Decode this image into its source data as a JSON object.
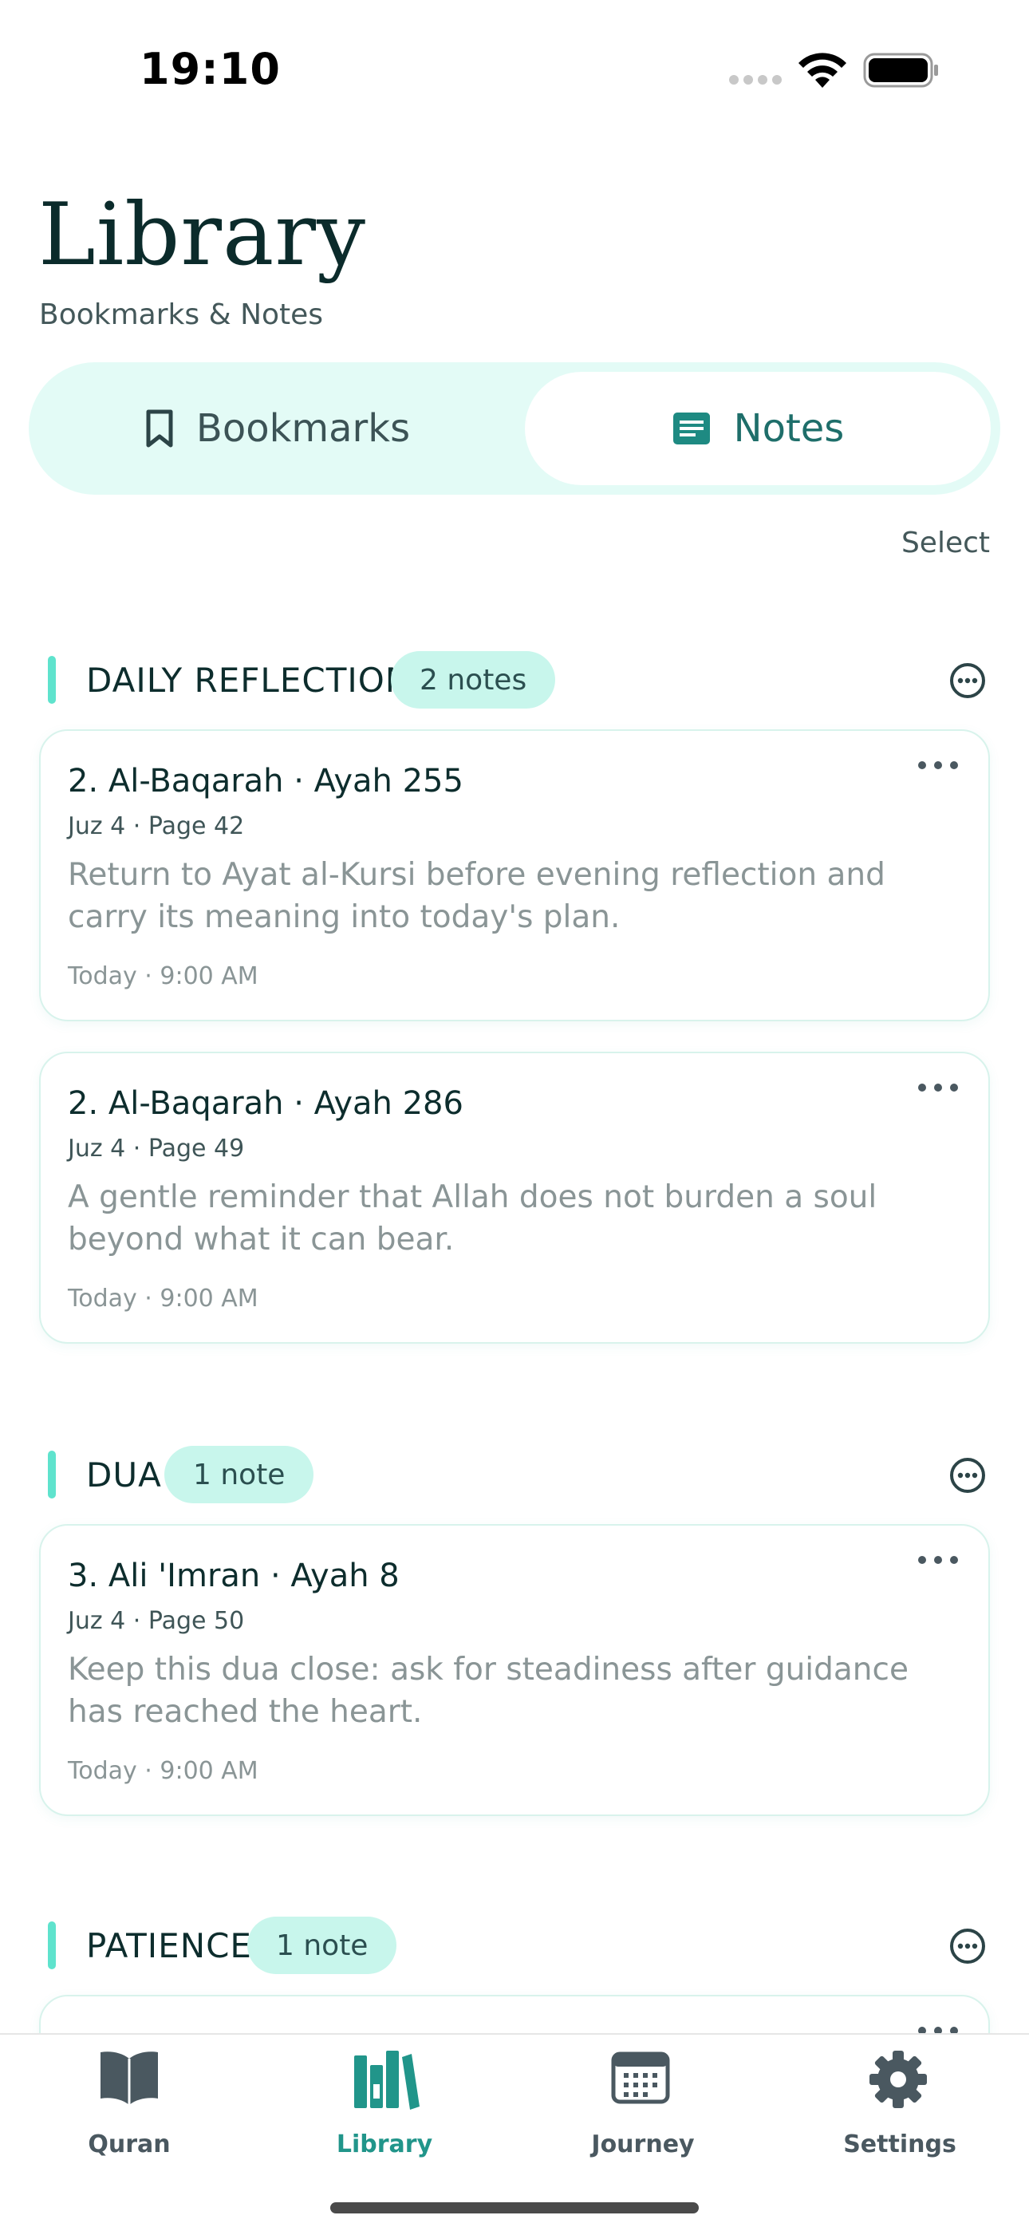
{
  "status_bar": {
    "time": "19:10"
  },
  "header": {
    "title": "Library",
    "subtitle": "Bookmarks & Notes"
  },
  "segmented": {
    "bookmarks_label": "Bookmarks",
    "notes_label": "Notes",
    "active": "Notes"
  },
  "select_label": "Select",
  "colors": {
    "accent": "#5fe3cd",
    "pill": "#c8f6ec",
    "active_tab": "#21958a",
    "segment_bg": "#e3fbf6"
  },
  "sections": [
    {
      "title": "DAILY REFLECTION",
      "count": "2 notes",
      "notes": [
        {
          "title": "2. Al-Baqarah · Ayah 255",
          "meta": "Juz 4 · Page 42",
          "body": "Return to Ayat al-Kursi before evening reflection and carry its meaning into today's plan.",
          "time": "Today · 9:00 AM"
        },
        {
          "title": "2. Al-Baqarah · Ayah 286",
          "meta": "Juz 4 · Page 49",
          "body": "A gentle reminder that Allah does not burden a soul beyond what it can bear.",
          "time": "Today · 9:00 AM"
        }
      ]
    },
    {
      "title": "DUA",
      "count": "1 note",
      "notes": [
        {
          "title": "3. Ali 'Imran · Ayah 8",
          "meta": "Juz 4 · Page 50",
          "body": "Keep this dua close: ask for steadiness after guidance has reached the heart.",
          "time": "Today · 9:00 AM"
        }
      ]
    },
    {
      "title": "PATIENCE",
      "count": "1 note",
      "notes": []
    }
  ],
  "tabs": [
    {
      "label": "Quran",
      "icon": "open-book-icon"
    },
    {
      "label": "Library",
      "icon": "library-books-icon",
      "active": true
    },
    {
      "label": "Journey",
      "icon": "calendar-icon"
    },
    {
      "label": "Settings",
      "icon": "gear-icon"
    }
  ]
}
